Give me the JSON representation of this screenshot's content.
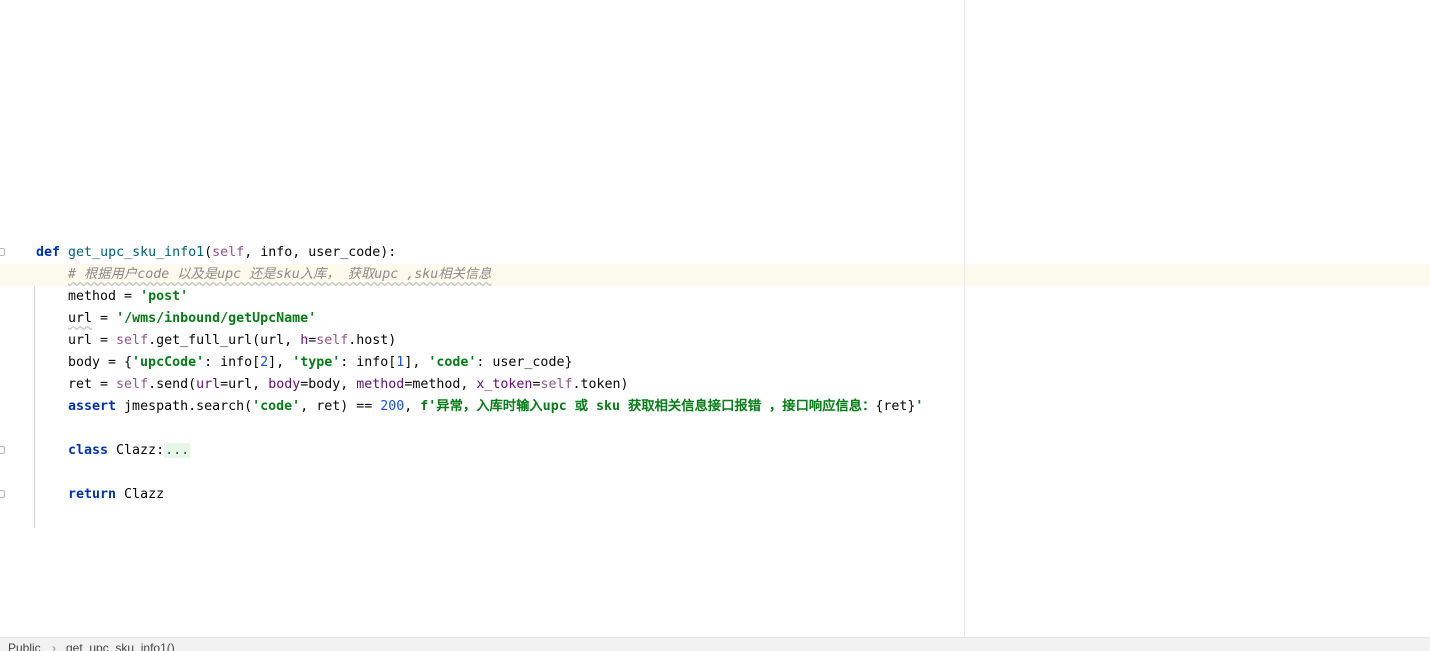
{
  "editor": {
    "lines": [
      {
        "text_def": "def",
        "fn_name": "get_upc_sku_info1",
        "sig_self": "self",
        "sig_rest": ", info, user_code):"
      },
      {
        "comment": "# 根据用户code 以及是upc 还是sku入库， 获取upc ,sku相关信息"
      },
      {
        "var": "method",
        "op": " = ",
        "str": "'post'"
      },
      {
        "var": "url",
        "op": " = ",
        "str": "'/wms/inbound/getUpcName'"
      },
      {
        "line4": {
          "a": "url = ",
          "self1": "self",
          "b": ".get_full_url(url, ",
          "h": "h",
          "c": "=",
          "self2": "self",
          "d": ".host)"
        }
      },
      {
        "line5": {
          "a": "body = {",
          "k1": "'upcCode'",
          "b": ": info[",
          "n1": "2",
          "c": "], ",
          "k2": "'type'",
          "d": ": info[",
          "n2": "1",
          "e": "], ",
          "k3": "'code'",
          "f": ": user_code}"
        }
      },
      {
        "line6": {
          "a": "ret = ",
          "self1": "self",
          "b": ".send(",
          "p1": "url",
          "c": "=url, ",
          "p2": "body",
          "d": "=body, ",
          "p3": "method",
          "e": "=method, ",
          "p4": "x_token",
          "f": "=",
          "self2": "self",
          "g": ".token)"
        }
      },
      {
        "line7": {
          "kw": "assert",
          "a": " jmespath.search(",
          "s1": "'code'",
          "b": ", ret) == ",
          "n": "200",
          "c": ", ",
          "fstr": "f'异常，入库时输入upc 或 sku 获取相关信息接口报错 ，接口响应信息：",
          "d": "{ret}",
          "e": "'"
        }
      },
      {
        "line9": {
          "kw": "class",
          "a": " Clazz:",
          "fold": "..."
        }
      },
      {
        "line11": {
          "kw": "return",
          "a": " Clazz"
        }
      }
    ]
  },
  "breadcrumb": {
    "item1": "Public",
    "separator": "›",
    "item2": "get_upc_sku_info1()"
  }
}
